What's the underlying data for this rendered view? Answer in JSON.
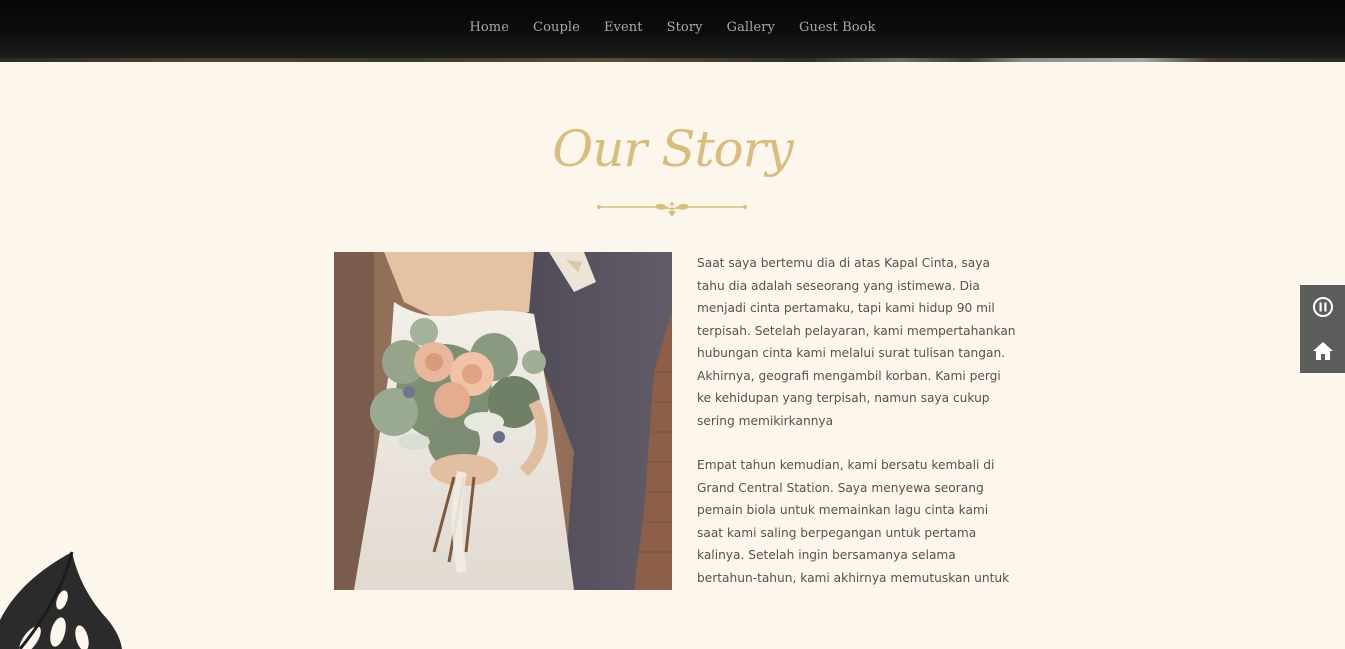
{
  "nav": {
    "items": [
      {
        "label": "Home"
      },
      {
        "label": "Couple"
      },
      {
        "label": "Event"
      },
      {
        "label": "Story"
      },
      {
        "label": "Gallery"
      },
      {
        "label": "Guest Book"
      }
    ]
  },
  "story": {
    "title": "Our Story",
    "paragraphs": [
      "Saat saya bertemu dia di atas Kapal Cinta, saya tahu dia adalah seseorang yang istimewa. Dia menjadi cinta pertamaku, tapi kami hidup 90 mil terpisah. Setelah pelayaran, kami mempertahankan hubungan cinta kami melalui surat tulisan tangan. Akhirnya, geografi mengambil korban. Kami pergi ke kehidupan yang terpisah, namun saya cukup sering memikirkannya",
      "Empat tahun kemudian, kami bersatu kembali di Grand Central Station. Saya menyewa seorang pemain biola untuk memainkan lagu cinta kami saat kami saling berpegangan untuk pertama kalinya. Setelah ingin bersamanya selama bertahun-tahun, kami akhirnya memutuskan untuk"
    ]
  },
  "side_controls": {
    "pause_icon": "pause-circle-icon",
    "home_icon": "home-icon"
  },
  "colors": {
    "background": "#fdf6ec",
    "accent_gold": "#d8bd80",
    "nav_text": "#a9a9a9",
    "body_text": "#5a524a",
    "side_panel": "#5d5d5d"
  }
}
